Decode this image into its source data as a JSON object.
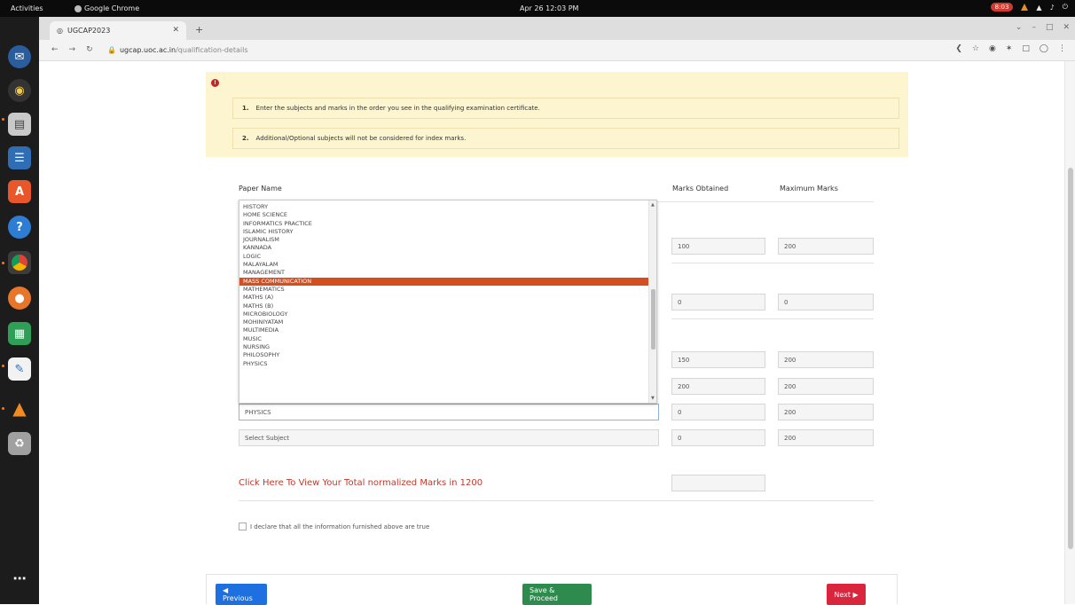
{
  "system": {
    "activities": "Activities",
    "app_name": "Google Chrome",
    "clock": "Apr 26  12:03 PM",
    "record_time": "8:03"
  },
  "browser": {
    "tab_title": "UGCAP2023",
    "url_domain": "ugcap.uoc.ac.in",
    "url_path": "/qualification-details"
  },
  "alert": {
    "items": [
      {
        "num": "1.",
        "text": "Enter the subjects and marks in the order you see in the qualifying examination certificate."
      },
      {
        "num": "2.",
        "text": "Additional/Optional subjects will not be considered for index marks."
      }
    ]
  },
  "table": {
    "headers": {
      "paper": "Paper Name",
      "obtained": "Marks Obtained",
      "maximum": "Maximum Marks"
    },
    "rows": [
      {
        "paper": "",
        "obtained": "100",
        "maximum": "200"
      },
      {
        "paper": "",
        "obtained": "0",
        "maximum": "0"
      },
      {
        "paper": "",
        "obtained": "150",
        "maximum": "200"
      },
      {
        "paper": "",
        "obtained": "200",
        "maximum": "200"
      },
      {
        "paper": "PHYSICS",
        "obtained": "0",
        "maximum": "200"
      },
      {
        "paper": "Select Subject",
        "obtained": "0",
        "maximum": "200"
      }
    ]
  },
  "dropdown": {
    "options": [
      "HISTORY",
      "HOME SCIENCE",
      "INFORMATICS PRACTICE",
      "ISLAMIC HISTORY",
      "JOURNALISM",
      "KANNADA",
      "LOGIC",
      "MALAYALAM",
      "MANAGEMENT",
      "MASS COMMUNICATION",
      "MATHEMATICS",
      "MATHS (A)",
      "MATHS (B)",
      "MICROBIOLOGY",
      "MOHINIYATAM",
      "MULTIMEDIA",
      "MUSIC",
      "NURSING",
      "PHILOSOPHY",
      "PHYSICS"
    ],
    "highlighted": "MASS COMMUNICATION"
  },
  "total_link": "Click Here To View Your Total normalized Marks in 1200",
  "total_value": "",
  "declaration": "I declare that all the information furnished above are true",
  "buttons": {
    "previous": "◀ Previous",
    "save": "Save & Proceed",
    "next": "Next ▶"
  },
  "colors": {
    "alert_bg": "#fcf5cf",
    "highlight": "#d44f1f",
    "link": "#c0392b",
    "previous": "#1e6fe0",
    "save": "#2e8b4e",
    "next": "#d9263d"
  }
}
